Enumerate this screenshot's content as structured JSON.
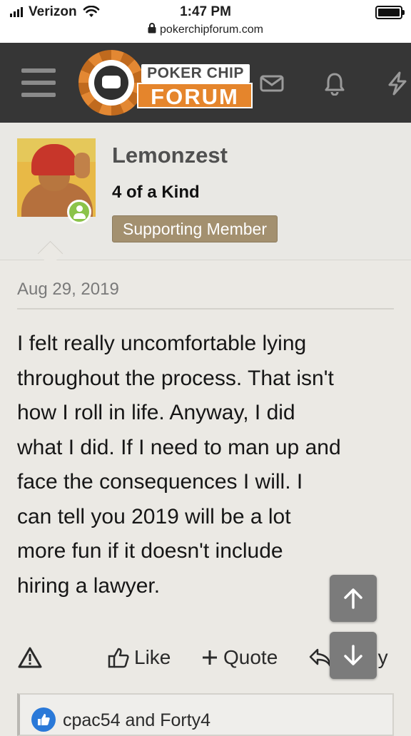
{
  "status_bar": {
    "carrier": "Verizon",
    "time": "1:47 PM",
    "url": "pokerchipforum.com"
  },
  "header": {
    "logo_top": "POKER CHIP",
    "logo_bottom": "FORUM",
    "icons": [
      "menu-icon",
      "mail-icon",
      "bell-icon",
      "lightning-icon"
    ]
  },
  "user": {
    "name": "Lemonzest",
    "title": "4 of a Kind",
    "badge": "Supporting Member"
  },
  "post": {
    "date": "Aug 29, 2019",
    "lines": [
      "I felt really uncomfortable lying",
      "throughout the process. That isn't",
      "how I roll in life. Anyway, I did",
      "what I did. If I need to man up and",
      "face the consequences I will. I",
      "can tell you 2019 will be a lot",
      "more fun if it doesn't include",
      "hiring a lawyer."
    ]
  },
  "actions": {
    "like": "Like",
    "quote": "Quote",
    "reply": "Reply"
  },
  "likes": {
    "text": "cpac54 and Forty4"
  },
  "colors": {
    "header_bg": "#363636",
    "logo_orange": "#e5852c",
    "badge_bg": "#a3906f",
    "online_green": "#8bc34a",
    "like_blue": "#2a79d8"
  }
}
